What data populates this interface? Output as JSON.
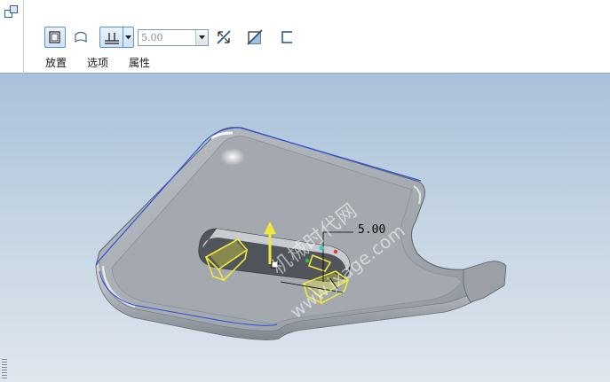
{
  "toolbar": {
    "thickness_value": "5.00",
    "tabs": [
      {
        "label": "放置"
      },
      {
        "label": "选项"
      },
      {
        "label": "属性"
      }
    ]
  },
  "viewport": {
    "dimension_label": "5.00",
    "watermark_text": "机械时代网",
    "watermark_url": "www.jxage.com"
  },
  "icons": {
    "dashboard": "feature-dashboard-icon",
    "solid": "solid-thicken-icon",
    "surface": "surface-icon",
    "thickness_mode": "offset-thickness-icon",
    "dropdown": "chevron-down-icon",
    "flip": "flip-direction-icon",
    "remove_material": "remove-material-icon",
    "sketch_side": "side-option-icon"
  },
  "colors": {
    "active_border": "#5f93c6",
    "preview_yellow": "#f1e93a",
    "part_gray": "#a7adb3"
  }
}
